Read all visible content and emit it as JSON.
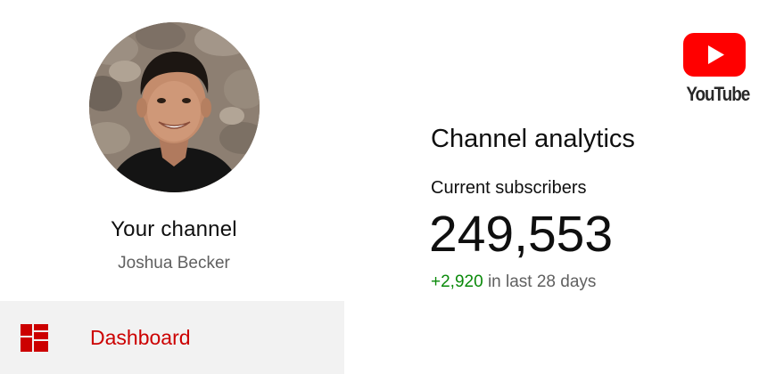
{
  "sidebar": {
    "channel_label": "Your channel",
    "channel_name": "Joshua Becker",
    "nav": [
      {
        "label": "Dashboard",
        "icon": "dashboard-icon",
        "active": true
      }
    ]
  },
  "brand": {
    "logo_text": "YouTube",
    "logo_color": "#ff0000",
    "accent": "#cc0000"
  },
  "analytics": {
    "title": "Channel analytics",
    "subscribers_label": "Current subscribers",
    "subscribers_count": "249,553",
    "change_delta": "+2,920",
    "change_period": "in last 28 days",
    "positive_color": "#0a8a0a"
  }
}
